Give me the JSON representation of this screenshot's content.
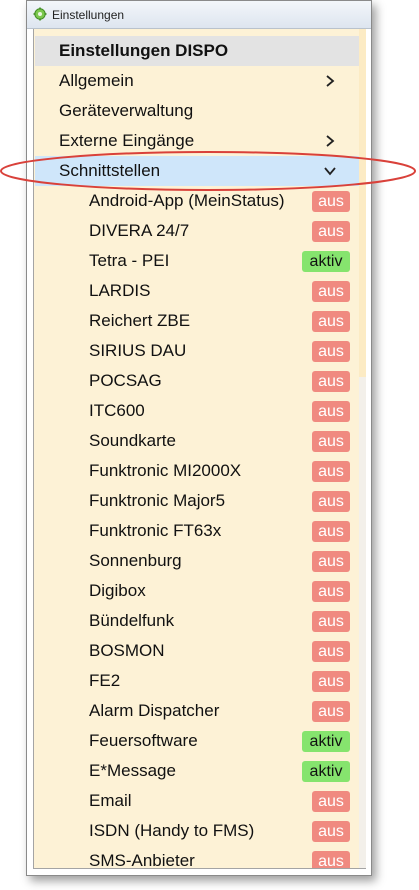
{
  "window": {
    "title": "Einstellungen"
  },
  "header": {
    "label": "Einstellungen DISPO"
  },
  "menu": [
    {
      "label": "Allgemein",
      "chevron": "chevron-right-icon",
      "selected": false
    },
    {
      "label": "Geräteverwaltung",
      "chevron": "",
      "selected": false
    },
    {
      "label": "Externe Eingänge",
      "chevron": "chevron-right-icon",
      "selected": false
    },
    {
      "label": "Schnittstellen",
      "chevron": "chevron-down-icon",
      "selected": true
    }
  ],
  "interfaces": [
    {
      "label": "Android-App (MeinStatus)",
      "status": "aus"
    },
    {
      "label": "DIVERA 24/7",
      "status": "aus"
    },
    {
      "label": "Tetra - PEI",
      "status": "aktiv"
    },
    {
      "label": "LARDIS",
      "status": "aus"
    },
    {
      "label": "Reichert ZBE",
      "status": "aus"
    },
    {
      "label": "SIRIUS DAU",
      "status": "aus"
    },
    {
      "label": "POCSAG",
      "status": "aus"
    },
    {
      "label": "ITC600",
      "status": "aus"
    },
    {
      "label": "Soundkarte",
      "status": "aus"
    },
    {
      "label": "Funktronic MI2000X",
      "status": "aus"
    },
    {
      "label": "Funktronic Major5",
      "status": "aus"
    },
    {
      "label": "Funktronic FT63x",
      "status": "aus"
    },
    {
      "label": "Sonnenburg",
      "status": "aus"
    },
    {
      "label": "Digibox",
      "status": "aus"
    },
    {
      "label": "Bündelfunk",
      "status": "aus"
    },
    {
      "label": "BOSMON",
      "status": "aus"
    },
    {
      "label": "FE2",
      "status": "aus"
    },
    {
      "label": "Alarm Dispatcher",
      "status": "aus"
    },
    {
      "label": "Feuersoftware",
      "status": "aktiv"
    },
    {
      "label": "E*Message",
      "status": "aktiv"
    },
    {
      "label": "Email",
      "status": "aus"
    },
    {
      "label": "ISDN (Handy to FMS)",
      "status": "aus"
    },
    {
      "label": "SMS-Anbieter",
      "status": "aus"
    }
  ],
  "colors": {
    "panel_bg": "#fdf2d6",
    "header_bg": "#e3e3e3",
    "selected_bg": "#cfe6fa",
    "aus_badge": "#f08a80",
    "aktiv_badge": "#86e46e",
    "highlight_ellipse": "#d9413a"
  }
}
